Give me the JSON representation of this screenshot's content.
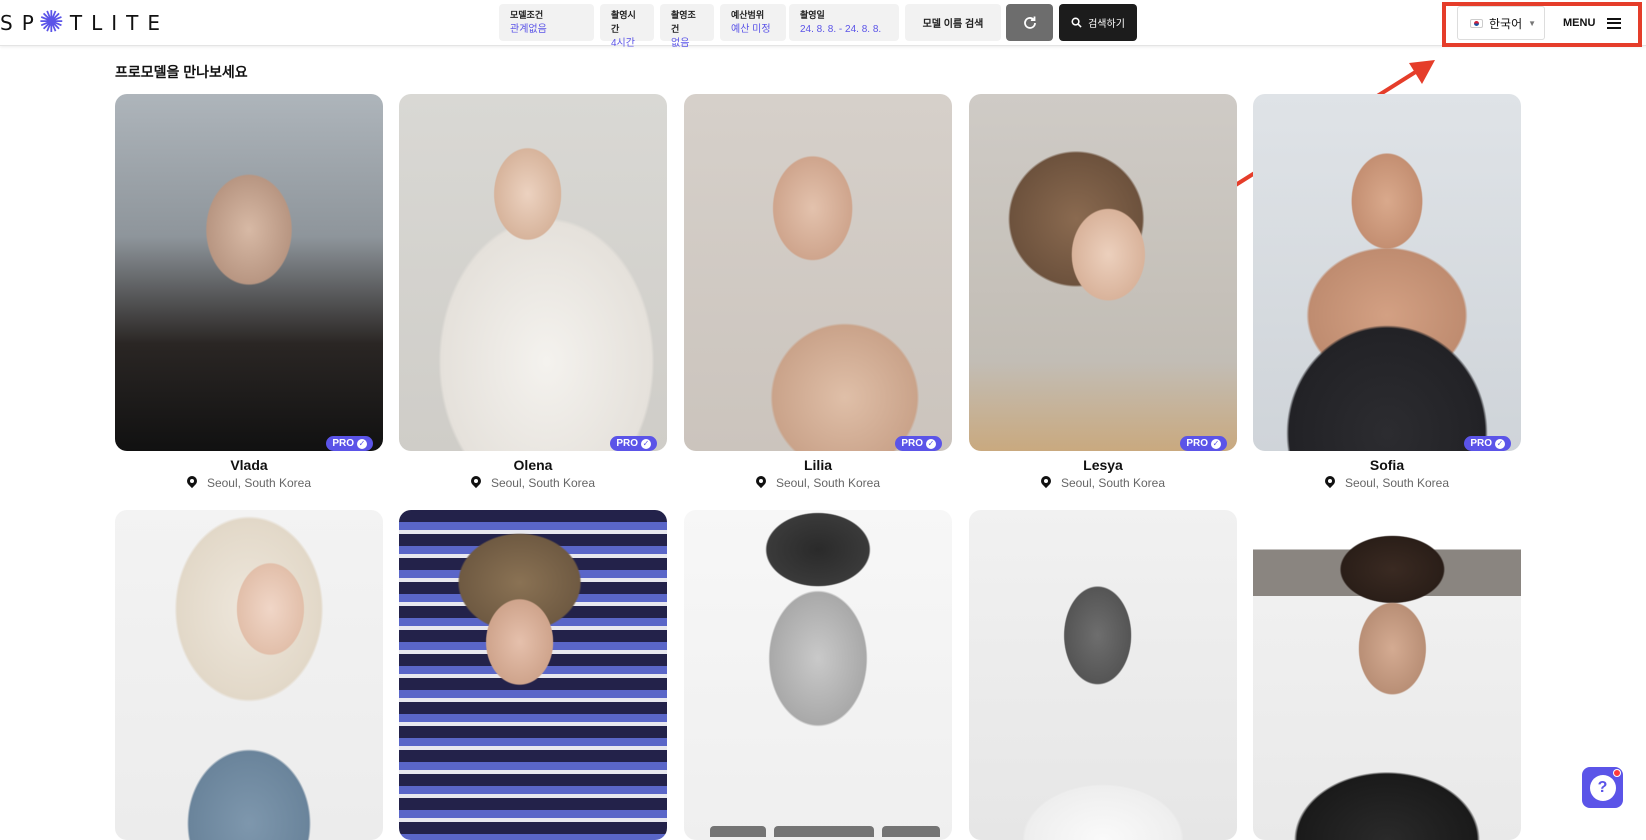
{
  "header": {
    "logo": "SP TLITE",
    "filters": [
      {
        "label": "모델조건",
        "value": "관계없음"
      },
      {
        "label": "촬영시간",
        "value": "4시간"
      },
      {
        "label": "촬영조건",
        "value": "없음"
      },
      {
        "label": "예산범위",
        "value": "예산 미정"
      },
      {
        "label": "촬영일",
        "value": "24. 8. 8. - 24. 8. 8."
      }
    ],
    "name_search_label": "모델 이름 검색",
    "search_label": "검색하기",
    "language": "한국어",
    "menu_label": "MENU"
  },
  "main": {
    "section_title": "프로모델을 만나보세요",
    "models": [
      {
        "name": "Vlada",
        "location": "Seoul, South Korea",
        "badge": "PRO"
      },
      {
        "name": "Olena",
        "location": "Seoul, South Korea",
        "badge": "PRO"
      },
      {
        "name": "Lilia",
        "location": "Seoul, South Korea",
        "badge": "PRO"
      },
      {
        "name": "Lesya",
        "location": "Seoul, South Korea",
        "badge": "PRO"
      },
      {
        "name": "Sofia",
        "location": "Seoul, South Korea",
        "badge": "PRO"
      }
    ]
  },
  "colors": {
    "accent": "#5b54e8",
    "annotation": "#e53d2a"
  }
}
